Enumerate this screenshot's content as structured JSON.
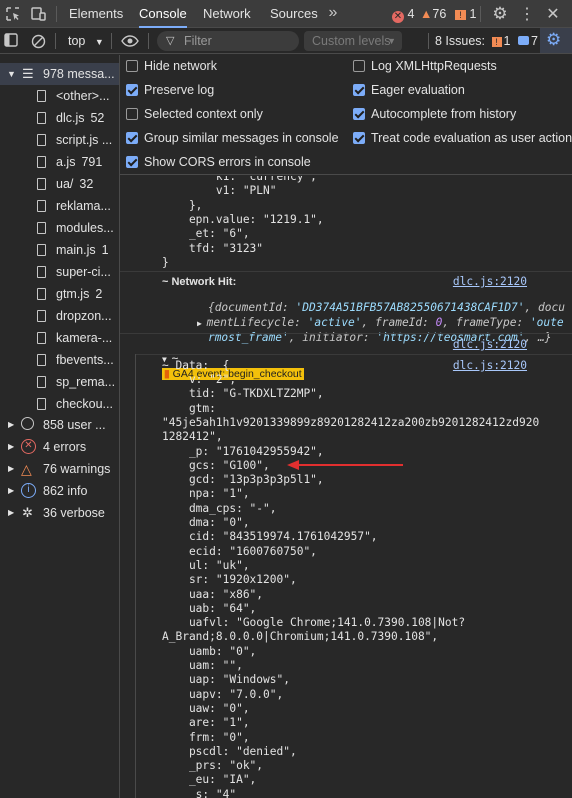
{
  "tabs": {
    "elements": "Elements",
    "console": "Console",
    "network": "Network",
    "sources": "Sources"
  },
  "badges": {
    "errors": "4",
    "warnings": "76",
    "issues": "1"
  },
  "toolbar": {
    "context": "top",
    "filter_placeholder": "Filter",
    "levels": "Custom levels",
    "issues_label": "8 Issues:",
    "issues_warn": "1",
    "issues_info": "7"
  },
  "sidebar": {
    "messages": "978 messa...",
    "files": [
      {
        "name": "<other>..."
      },
      {
        "name": "dlc.js",
        "count": "52"
      },
      {
        "name": "script.js ..."
      },
      {
        "name": "a.js",
        "count": "791"
      },
      {
        "name": "ua/",
        "count": "32"
      },
      {
        "name": "reklama..."
      },
      {
        "name": "modules..."
      },
      {
        "name": "main.js",
        "count": "1"
      },
      {
        "name": "super-ci..."
      },
      {
        "name": "gtm.js",
        "count": "2"
      },
      {
        "name": "dropzon..."
      },
      {
        "name": "kamera-..."
      },
      {
        "name": "fbevents..."
      },
      {
        "name": "sp_rema..."
      },
      {
        "name": "checkou..."
      }
    ],
    "user": "858 user ...",
    "errors": "4 errors",
    "warnings": "76 warnings",
    "info": "862 info",
    "verbose": "36 verbose"
  },
  "settings": {
    "hide_network": "Hide network",
    "preserve_log": "Preserve log",
    "selected_context": "Selected context only",
    "group_similar": "Group similar messages in console",
    "cors_errors": "Show CORS errors in console",
    "log_xhr": "Log XMLHttpRequests",
    "eager_eval": "Eager evaluation",
    "autocomplete": "Autocomplete from history",
    "treat_eval": "Treat code evaluation as user action"
  },
  "console": {
    "top_lines": [
      "        k1: \"currency\",",
      "        v1: \"PLN\"",
      "    },",
      "    epn.value: \"1219.1\",",
      "    _et: \"6\",",
      "    tfd: \"3123\"",
      "}"
    ],
    "network_hit": "~ Network Hit:",
    "network_link": "dlc.js:2120",
    "nh_line1a": "{documentId: ",
    "nh_line1b": "'DD374A51BFB57AB82550671438CAF1D7'",
    "nh_line1c": ", docu",
    "nh_line2a": "mentLifecycle: ",
    "nh_line2b": "'active'",
    "nh_line2c": ", frameId: ",
    "nh_line2d": "0",
    "nh_line2e": ", frameType: ",
    "nh_line2f": "'oute",
    "nh_line3a": "rmost_frame'",
    "nh_line3b": ", initiator: ",
    "nh_line3c": "'https://teosmart.com'",
    "nh_line3d": ", …}",
    "ga4_prefix": "~",
    "ga4_badge": "GA4 event: begin_checkout",
    "ga4_link": "dlc.js:2120",
    "data_label": "~ Data:  {",
    "data_link": "dlc.js:2120",
    "data_lines": [
      "    v: \"2\",",
      "    tid: \"G-TKDXLTZ2MP\",",
      "    gtm:",
      "\"45je5ah1h1v9201339899z89201282412za200zb9201282412zd920",
      "1282412\",",
      "    _p: \"1761042955942\",",
      "    gcs: \"G100\",",
      "    gcd: \"13p3p3p3p5l1\",",
      "    npa: \"1\",",
      "    dma_cps: \"-\",",
      "    dma: \"0\",",
      "    cid: \"843519974.1761042957\",",
      "    ecid: \"1600760750\",",
      "    ul: \"uk\",",
      "    sr: \"1920x1200\",",
      "    uaa: \"x86\",",
      "    uab: \"64\",",
      "    uafvl: \"Google Chrome;141.0.7390.108|Not?",
      "A_Brand;8.0.0.0|Chromium;141.0.7390.108\",",
      "    uamb: \"0\",",
      "    uam: \"\",",
      "    uap: \"Windows\",",
      "    uapv: \"7.0.0\",",
      "    uaw: \"0\",",
      "    are: \"1\",",
      "    frm: \"0\",",
      "    pscdl: \"denied\",",
      "    _prs: \"ok\",",
      "    _eu: \"IA\",",
      "    _s: \"4\""
    ]
  },
  "colors": {
    "accent": "#7cacf8",
    "error": "#e46962",
    "warning": "#f28b54",
    "arrow": "#e22f2f"
  }
}
